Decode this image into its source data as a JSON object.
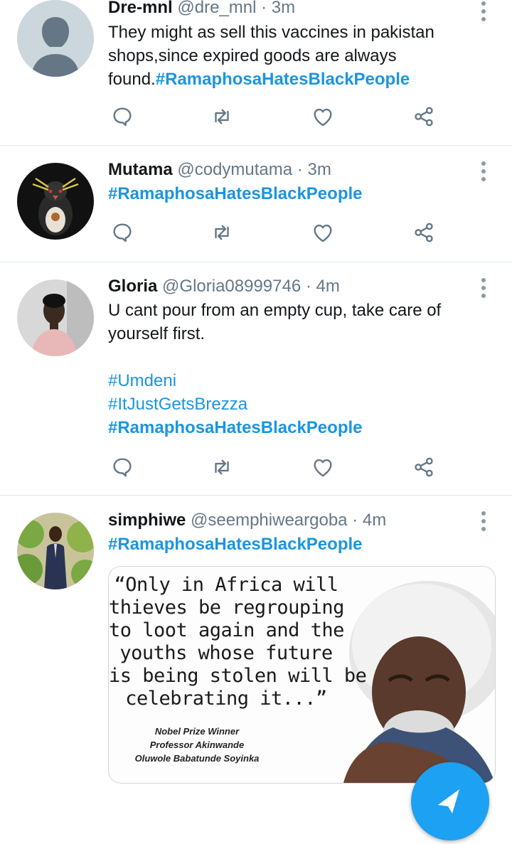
{
  "tweets": [
    {
      "name": "Dre-mnl",
      "handle": "@dre_mnl",
      "time": "3m",
      "text_lines": [
        "They might as sell this vaccines in pakistan",
        "shops,since expired goods are always",
        "found."
      ],
      "hashtags": [
        "#RamaphosaHatesBlackPeople"
      ]
    },
    {
      "name": "Mutama",
      "handle": "@codymutama",
      "time": "3m",
      "hashtags": [
        "#RamaphosaHatesBlackPeople"
      ]
    },
    {
      "name": "Gloria",
      "handle": "@Gloria08999746",
      "time": "4m",
      "text_lines": [
        "U cant pour from an empty cup, take care of",
        "yourself first."
      ],
      "hashtags": [
        "#Umdeni",
        "#ItJustGetsBrezza",
        "#RamaphosaHatesBlackPeople"
      ]
    },
    {
      "name": "simphiwe",
      "handle": "@seemphiweargoba",
      "time": "4m",
      "hashtags": [
        "#RamaphosaHatesBlackPeople"
      ],
      "media": {
        "quote_lines": [
          "“Only in Africa will",
          "thieves be regrouping",
          "to loot again and the",
          "youths whose future",
          "is being stolen will be",
          "celebrating it...”"
        ],
        "credit_lines": [
          "Nobel Prize Winner",
          "Professor Akinwande",
          "Oluwole Babatunde Soyinka"
        ]
      }
    }
  ],
  "separator": "·",
  "icons": [
    "reply-icon",
    "retweet-icon",
    "like-icon",
    "share-icon",
    "more-icon",
    "compose-icon"
  ],
  "colors": {
    "hashtag": "#1b95e0",
    "secondary_text": "#657786",
    "icon": "#657786",
    "divider": "#e1e8ed",
    "fab": "#1da1f2"
  }
}
